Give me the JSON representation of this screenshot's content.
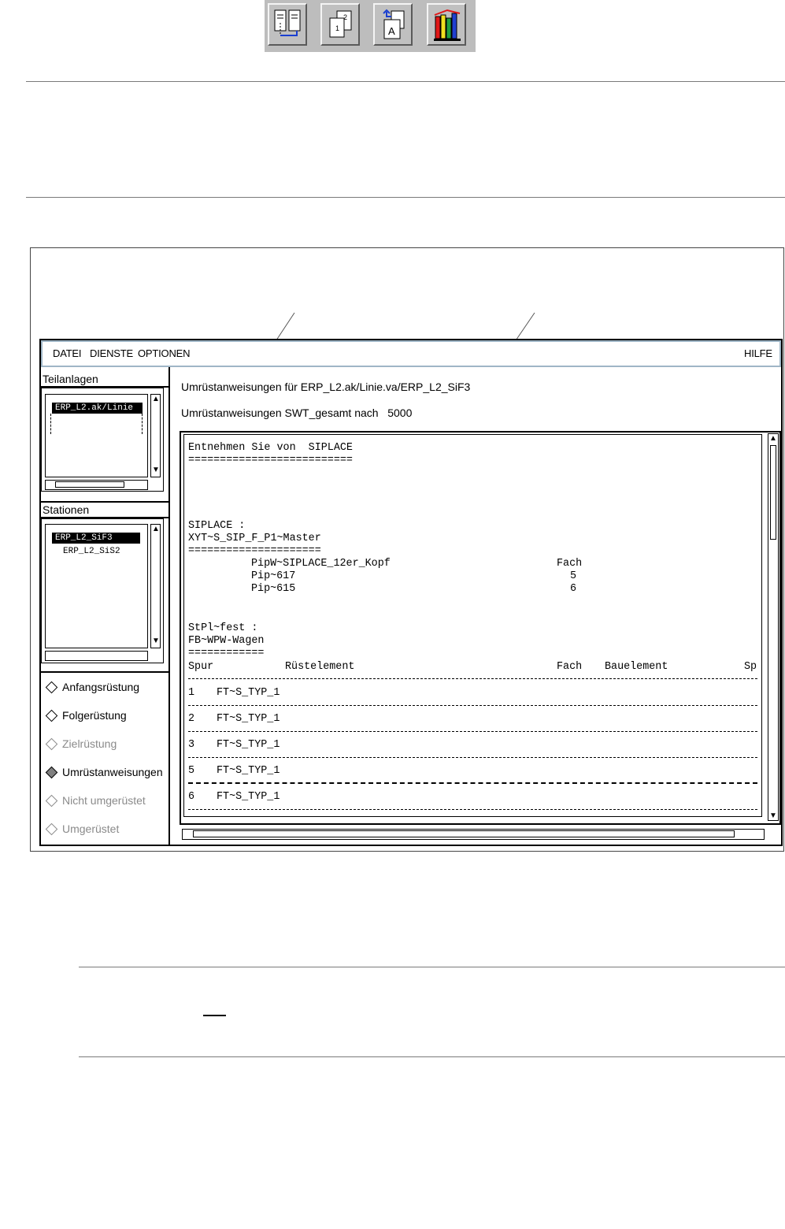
{
  "toolbar": {
    "icons": [
      "compare-columns-icon",
      "copy-page-icon",
      "replace-document-icon",
      "books-library-icon"
    ]
  },
  "window": {
    "menu": [
      "DATEI",
      "DIENSTE",
      "OPTIONEN"
    ],
    "help": "HILFE"
  },
  "teilanlagen": {
    "title": "Teilanlagen",
    "items": [
      "ERP_L2.ak/Linie"
    ]
  },
  "stationen": {
    "title": "Stationen",
    "items": [
      "ERP_L2_SiF3",
      "ERP_L2_SiS2"
    ]
  },
  "options": [
    {
      "label": "Anfangsrüstung",
      "state": "enabled"
    },
    {
      "label": "Folgerüstung",
      "state": "enabled"
    },
    {
      "label": "Zielrüstung",
      "state": "disabled"
    },
    {
      "label": "Umrüstanweisungen",
      "state": "selected"
    },
    {
      "label": "Nicht umgerüstet",
      "state": "disabled"
    },
    {
      "label": "Umgerüstet",
      "state": "disabled"
    }
  ],
  "header": {
    "line1": "Umrüstanweisungen für ERP_L2.ak/Linie.va/ERP_L2_SiF3",
    "line2": "Umrüstanweisungen SWT_gesamt nach   5000"
  },
  "content": {
    "heading": "Entnehmen Sie von  SIPLACE",
    "heading_rule": "==========================",
    "siplace": "SIPLACE :",
    "master": "XYT~S_SIP_F_P1~Master",
    "master_rule": "=====================",
    "pip_rows": [
      {
        "name": "PipW~SIPLACE_12er_Kopf",
        "fach": "Fach"
      },
      {
        "name": "Pip~617",
        "fach": "5"
      },
      {
        "name": "Pip~615",
        "fach": "6"
      }
    ],
    "stpl": "StPl~fest :",
    "wagen": "FB~WPW-Wagen",
    "wagen_rule": "============",
    "table_headers": {
      "spur": "Spur",
      "ruestelement": "Rüstelement",
      "fach": "Fach",
      "bauelement": "Bauelement",
      "sp": "Sp"
    },
    "table_rows": [
      {
        "spur": "1",
        "element": "FT~S_TYP_1"
      },
      {
        "spur": "2",
        "element": "FT~S_TYP_1"
      },
      {
        "spur": "3",
        "element": "FT~S_TYP_1"
      },
      {
        "spur": "5",
        "element": "FT~S_TYP_1"
      },
      {
        "spur": "6",
        "element": "FT~S_TYP_1"
      }
    ]
  }
}
